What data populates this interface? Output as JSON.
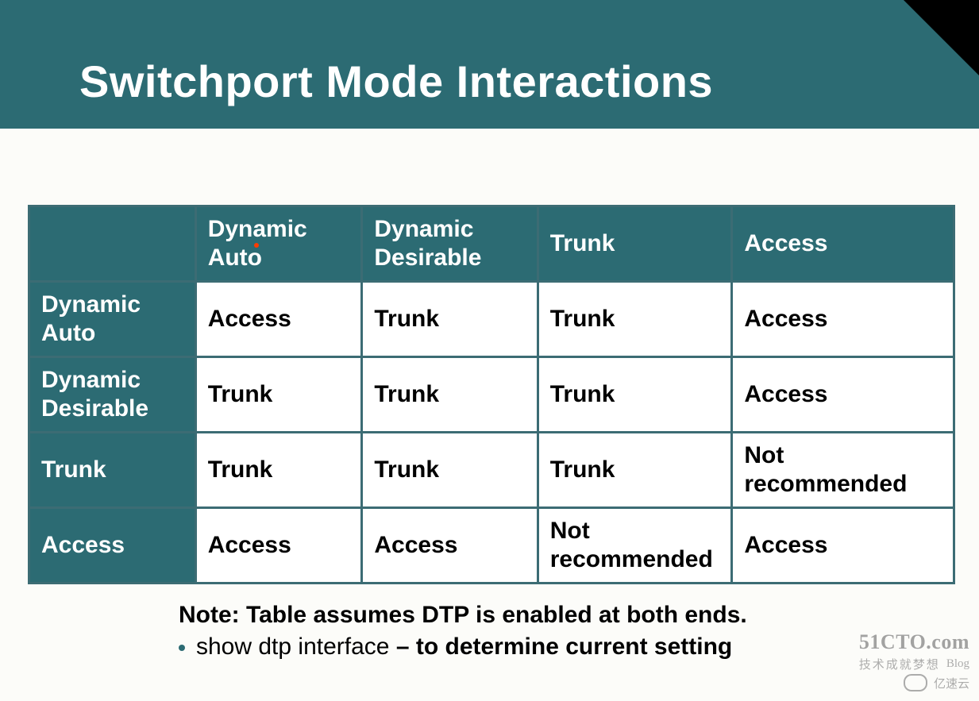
{
  "title": "Switchport Mode Interactions",
  "table": {
    "columns": [
      "",
      "Dynamic Auto",
      "Dynamic Desirable",
      "Trunk",
      "Access"
    ],
    "rows": [
      {
        "header": "Dynamic Auto",
        "cells": [
          "Access",
          "Trunk",
          "Trunk",
          "Access"
        ]
      },
      {
        "header": "Dynamic Desirable",
        "cells": [
          "Trunk",
          "Trunk",
          "Trunk",
          "Access"
        ]
      },
      {
        "header": "Trunk",
        "cells": [
          "Trunk",
          "Trunk",
          "Trunk",
          "Not recommended"
        ]
      },
      {
        "header": "Access",
        "cells": [
          "Access",
          "Access",
          "Not recommended",
          "Access"
        ]
      }
    ]
  },
  "note": {
    "line": "Note: Table assumes DTP is enabled at both ends.",
    "bullet_cmd": "show dtp interface",
    "bullet_sep": " – ",
    "bullet_rest": "to determine current setting"
  },
  "watermark": {
    "line1": "51CTO.com",
    "sub1": "技术成就梦想",
    "sub2": "Blog",
    "brand": "亿速云"
  }
}
